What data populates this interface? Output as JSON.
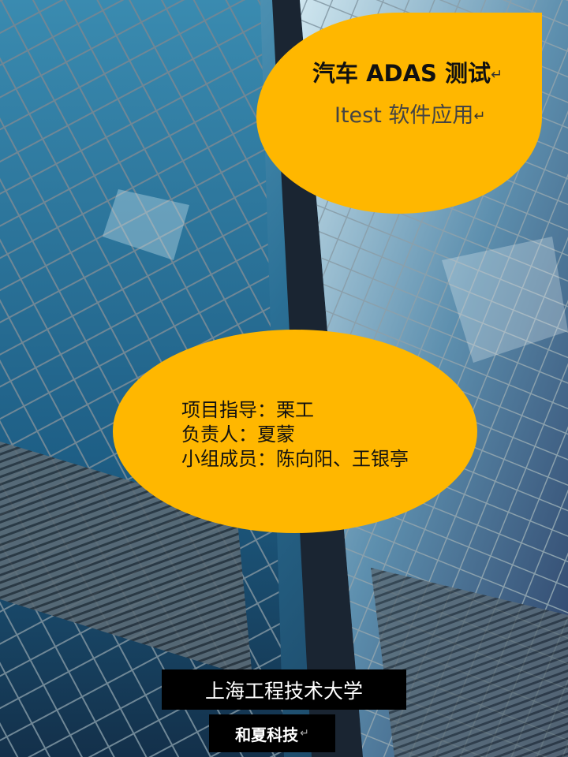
{
  "header": {
    "title": "汽车 ADAS 测试",
    "subtitle": "Itest 软件应用",
    "return_mark": "↵"
  },
  "team": {
    "lines": [
      "项目指导：栗工",
      "负责人：夏蒙",
      "小组成员：陈向阳、王银亭"
    ]
  },
  "footer": {
    "university": "上海工程技术大学",
    "company": "和夏科技",
    "return_mark": "↵"
  },
  "colors": {
    "accent": "#ffb700",
    "label_bg": "#000000",
    "sky": "#1b3a55"
  }
}
